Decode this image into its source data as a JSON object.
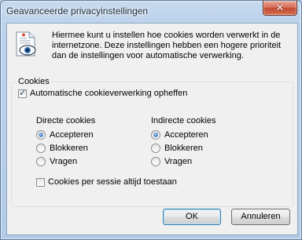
{
  "window": {
    "title": "Geavanceerde privacyinstellingen",
    "close_glyph": "✕"
  },
  "intro_text": "Hiermee kunt u instellen hoe cookies worden verwerkt in de internetzone. Deze instellingen hebben een hogere prioriteit dan de instellingen voor automatische verwerking.",
  "cookies_group": {
    "legend": "Cookies",
    "override": {
      "label": "Automatische cookieverwerking opheffen",
      "checked": true
    },
    "first_party": {
      "heading": "Directe cookies",
      "options": [
        "Accepteren",
        "Blokkeren",
        "Vragen"
      ],
      "selected": "Accepteren"
    },
    "third_party": {
      "heading": "Indirecte cookies",
      "options": [
        "Accepteren",
        "Blokkeren",
        "Vragen"
      ],
      "selected": "Accepteren"
    },
    "session_cookies": {
      "label": "Cookies per sessie altijd toestaan",
      "checked": false
    }
  },
  "buttons": {
    "ok": "OK",
    "cancel": "Annuleren"
  },
  "icons": {
    "privacy": "privacy-document-eye-icon",
    "close": "close-icon"
  },
  "colors": {
    "radio_dot": "#1f58a6",
    "close_button": "#c24a32",
    "frame": "#b9d1ea"
  }
}
